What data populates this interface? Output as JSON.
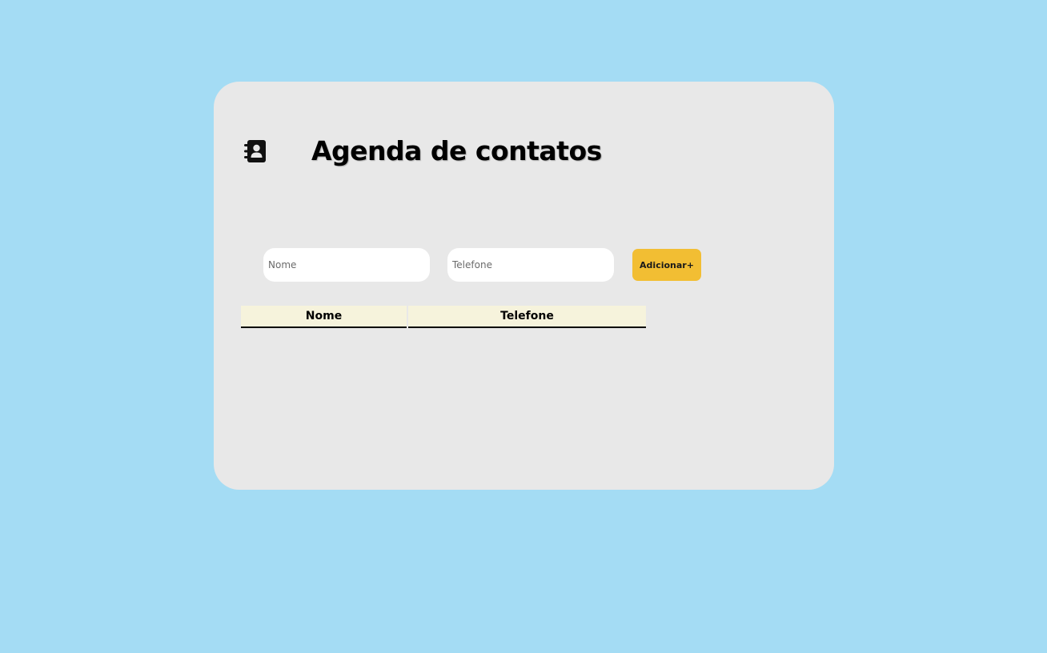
{
  "header": {
    "title": "Agenda de contatos",
    "icon": "address-book-icon"
  },
  "form": {
    "name_placeholder": "Nome",
    "name_value": "",
    "phone_placeholder": "Telefone",
    "phone_value": "",
    "add_label": "Adicionar+"
  },
  "table": {
    "columns": [
      "Nome",
      "Telefone"
    ],
    "rows": []
  },
  "colors": {
    "background": "#a4dcf4",
    "card": "#e8e8e8",
    "accent_button": "#f2be33",
    "table_header": "#f6f3dc"
  }
}
